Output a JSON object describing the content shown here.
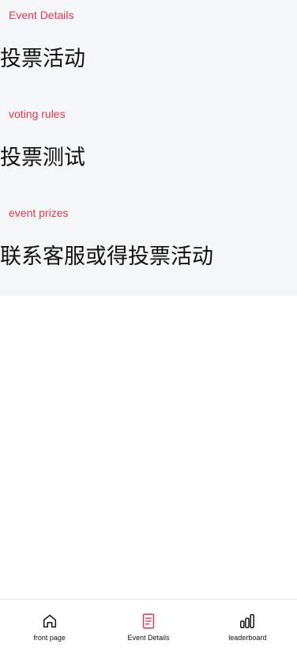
{
  "sections": [
    {
      "label": "Event Details",
      "value": "投票活动"
    },
    {
      "label": "voting rules",
      "value": "投票测试"
    },
    {
      "label": "event prizes",
      "value": "联系客服或得投票活动"
    }
  ],
  "tabbar": {
    "items": [
      {
        "label": "front page",
        "icon": "home-icon",
        "active": false
      },
      {
        "label": "Event Details",
        "icon": "document-icon",
        "active": true
      },
      {
        "label": "leaderboard",
        "icon": "bar-chart-icon",
        "active": false
      }
    ]
  },
  "colors": {
    "accent": "#e8344e",
    "content_bg": "#f5f6f7",
    "text": "#111111"
  }
}
